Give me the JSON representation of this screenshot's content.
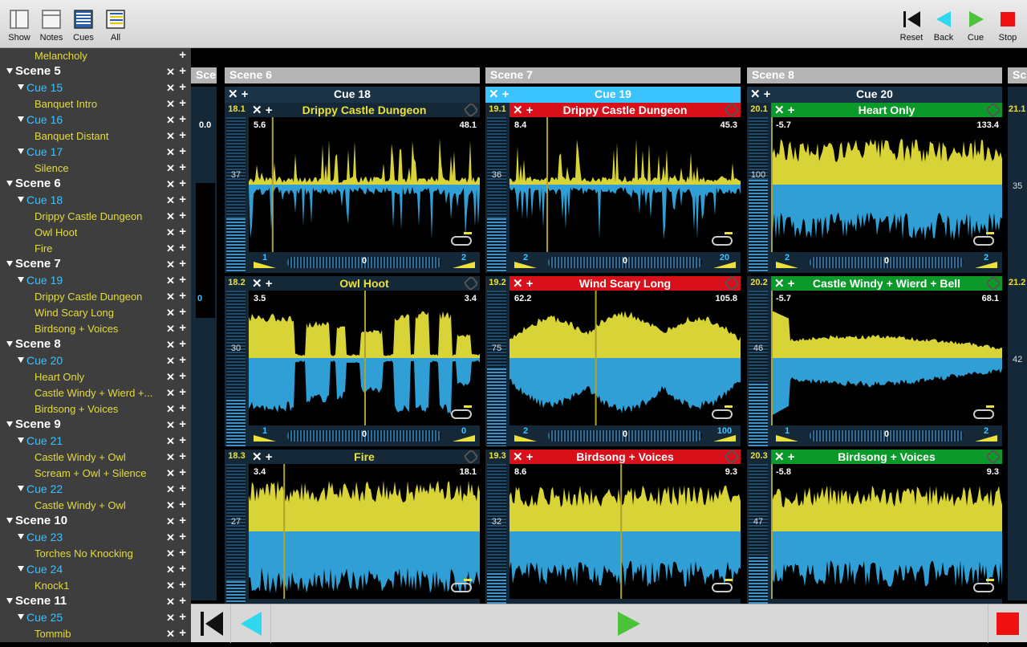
{
  "toolbar": {
    "left": [
      {
        "label": "Show",
        "icon": "show-icon"
      },
      {
        "label": "Notes",
        "icon": "notes-icon"
      },
      {
        "label": "Cues",
        "icon": "cues-icon"
      },
      {
        "label": "All",
        "icon": "all-icon"
      }
    ],
    "right": [
      {
        "label": "Reset",
        "icon": "skip-back-icon"
      },
      {
        "label": "Back",
        "icon": "back-triangle-icon"
      },
      {
        "label": "Cue",
        "icon": "play-icon"
      },
      {
        "label": "Stop",
        "icon": "stop-icon"
      }
    ]
  },
  "sidebar": {
    "rows": [
      {
        "type": "item",
        "label": "Melancholy"
      },
      {
        "type": "scene",
        "label": "Scene 5"
      },
      {
        "type": "cue",
        "label": "Cue 15"
      },
      {
        "type": "item",
        "label": "Banquet Intro"
      },
      {
        "type": "cue",
        "label": "Cue 16"
      },
      {
        "type": "item",
        "label": "Banquet Distant"
      },
      {
        "type": "cue",
        "label": "Cue 17"
      },
      {
        "type": "item",
        "label": "Silence"
      },
      {
        "type": "scene",
        "label": "Scene 6"
      },
      {
        "type": "cue",
        "label": "Cue 18"
      },
      {
        "type": "item",
        "label": "Drippy Castle Dungeon"
      },
      {
        "type": "item",
        "label": "Owl Hoot"
      },
      {
        "type": "item",
        "label": "Fire"
      },
      {
        "type": "scene",
        "label": "Scene 7"
      },
      {
        "type": "cue",
        "label": "Cue 19"
      },
      {
        "type": "item",
        "label": "Drippy Castle Dungeon"
      },
      {
        "type": "item",
        "label": "Wind Scary Long"
      },
      {
        "type": "item",
        "label": "Birdsong + Voices"
      },
      {
        "type": "scene",
        "label": "Scene 8"
      },
      {
        "type": "cue",
        "label": "Cue 20"
      },
      {
        "type": "item",
        "label": "Heart Only"
      },
      {
        "type": "item",
        "label": "Castle Windy + Wierd +..."
      },
      {
        "type": "item",
        "label": "Birdsong + Voices"
      },
      {
        "type": "scene",
        "label": "Scene 9"
      },
      {
        "type": "cue",
        "label": "Cue 21"
      },
      {
        "type": "item",
        "label": "Castle Windy + Owl"
      },
      {
        "type": "item",
        "label": "Scream + Owl + Silence"
      },
      {
        "type": "cue",
        "label": "Cue 22"
      },
      {
        "type": "item",
        "label": "Castle Windy + Owl"
      },
      {
        "type": "scene",
        "label": "Scene 10"
      },
      {
        "type": "cue",
        "label": "Cue 23"
      },
      {
        "type": "item",
        "label": "Torches No Knocking"
      },
      {
        "type": "cue",
        "label": "Cue 24"
      },
      {
        "type": "item",
        "label": "Knock1"
      },
      {
        "type": "scene",
        "label": "Scene 11"
      },
      {
        "type": "cue",
        "label": "Cue 25"
      },
      {
        "type": "item",
        "label": "Tommib"
      }
    ],
    "remove_glyph": "✕",
    "add_glyph": "+"
  },
  "scenes": [
    {
      "label": "Scene 5"
    },
    {
      "label": "Scene 6"
    },
    {
      "label": "Scene 7"
    },
    {
      "label": "Scene 8"
    },
    {
      "label": "Sc"
    }
  ],
  "cue_headers": [
    {
      "label": "Cue 18",
      "selected": false
    },
    {
      "label": "Cue 19",
      "selected": true
    },
    {
      "label": "Cue 20",
      "selected": false
    }
  ],
  "partial_left_column": {
    "start": "0.0",
    "left_value": "0"
  },
  "partial_right_column": {
    "rows": [
      "21.1",
      "21.2"
    ],
    "volume": "35",
    "volume2": "42"
  },
  "cells": [
    {
      "id": "18.1",
      "name": "Drippy Castle Dungeon",
      "state": "stopped",
      "start": "5.6",
      "end": "48.1",
      "volume": "37",
      "left": "1",
      "pan": "0",
      "right": "2",
      "style": "dripping",
      "playhead": 0.1,
      "level": 0.35
    },
    {
      "id": "19.1",
      "name": "Drippy Castle Dungeon",
      "state": "playing",
      "start": "8.4",
      "end": "45.3",
      "volume": "36",
      "left": "2",
      "pan": "0",
      "right": "20",
      "style": "dripping",
      "playhead": 0.16,
      "level": 0.35
    },
    {
      "id": "20.1",
      "name": "Heart Only",
      "state": "ready",
      "start": "-5.7",
      "end": "133.4",
      "volume": "100",
      "left": "2",
      "pan": "0",
      "right": "2",
      "style": "dense",
      "playhead": 0.0,
      "level": 0.6
    },
    {
      "id": "18.2",
      "name": "Owl Hoot",
      "state": "stopped",
      "start": "3.5",
      "end": "3.4",
      "volume": "30",
      "left": "1",
      "pan": "0",
      "right": "0",
      "style": "owl",
      "playhead": 0.5,
      "level": 0.3
    },
    {
      "id": "19.2",
      "name": "Wind Scary Long",
      "state": "playing",
      "start": "62.2",
      "end": "105.8",
      "volume": "75",
      "left": "2",
      "pan": "0",
      "right": "100",
      "style": "wind",
      "playhead": 0.37,
      "level": 0.5
    },
    {
      "id": "20.2",
      "name": "Castle Windy + Wierd + Bell",
      "state": "ready",
      "start": "-5.7",
      "end": "68.1",
      "volume": "46",
      "left": "1",
      "pan": "0",
      "right": "2",
      "style": "castle",
      "playhead": 0.0,
      "level": 0.4
    },
    {
      "id": "18.3",
      "name": "Fire",
      "state": "stopped",
      "start": "3.4",
      "end": "18.1",
      "volume": "27",
      "left": "",
      "pan": "",
      "right": "",
      "style": "fire",
      "playhead": 0.15,
      "level": 0.25
    },
    {
      "id": "19.3",
      "name": "Birdsong + Voices",
      "state": "playing",
      "start": "8.6",
      "end": "9.3",
      "volume": "32",
      "left": "",
      "pan": "",
      "right": "",
      "style": "birds",
      "playhead": 0.48,
      "level": 0.3
    },
    {
      "id": "20.3",
      "name": "Birdsong + Voices",
      "state": "ready",
      "start": "-5.8",
      "end": "9.3",
      "volume": "47",
      "left": "",
      "pan": "",
      "right": "",
      "style": "birds",
      "playhead": 0.0,
      "level": 0.4
    }
  ],
  "colors": {
    "waveform_top": "#d8d438",
    "waveform_bottom": "#2f9fd6",
    "playing_red": "#d8101a",
    "ready_green": "#0b9a2a",
    "selected_cue": "#3bc3ff",
    "cue_text": "#3bc3ff",
    "item_text": "#e4dc3c"
  }
}
